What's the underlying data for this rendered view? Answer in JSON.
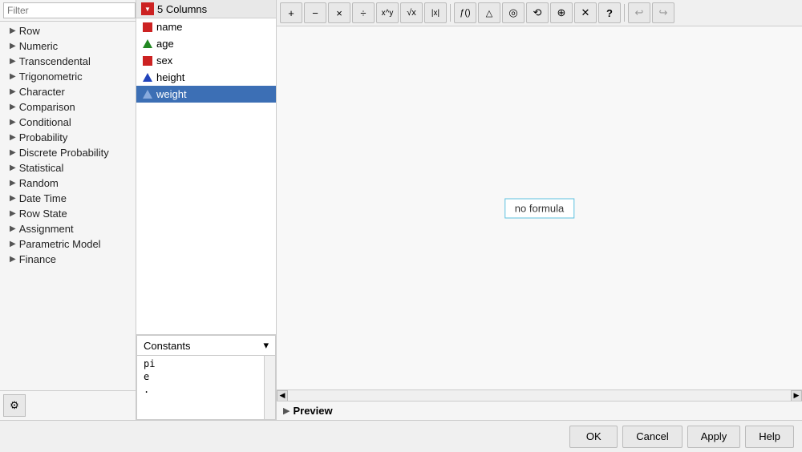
{
  "filter": {
    "placeholder": "Filter",
    "label": "Filter"
  },
  "categories": [
    {
      "id": "row",
      "label": "Row"
    },
    {
      "id": "numeric",
      "label": "Numeric"
    },
    {
      "id": "transcendental",
      "label": "Transcendental"
    },
    {
      "id": "trigonometric",
      "label": "Trigonometric"
    },
    {
      "id": "character",
      "label": "Character"
    },
    {
      "id": "comparison",
      "label": "Comparison"
    },
    {
      "id": "conditional",
      "label": "Conditional"
    },
    {
      "id": "probability",
      "label": "Probability"
    },
    {
      "id": "discrete-probability",
      "label": "Discrete Probability"
    },
    {
      "id": "statistical",
      "label": "Statistical"
    },
    {
      "id": "random",
      "label": "Random"
    },
    {
      "id": "date-time",
      "label": "Date Time"
    },
    {
      "id": "row-state",
      "label": "Row State"
    },
    {
      "id": "assignment",
      "label": "Assignment"
    },
    {
      "id": "parametric-model",
      "label": "Parametric Model"
    },
    {
      "id": "finance",
      "label": "Finance"
    }
  ],
  "columns_header": {
    "icon_label": "▼",
    "title": "5 Columns"
  },
  "columns": [
    {
      "id": "name",
      "label": "name",
      "type": "nominal"
    },
    {
      "id": "age",
      "label": "age",
      "type": "ordinal-num"
    },
    {
      "id": "sex",
      "label": "sex",
      "type": "nominal"
    },
    {
      "id": "height",
      "label": "height",
      "type": "continuous"
    },
    {
      "id": "weight",
      "label": "weight",
      "type": "continuous",
      "selected": true
    }
  ],
  "constants": {
    "label": "Constants",
    "items": [
      "pi",
      "e",
      "."
    ]
  },
  "toolbar": {
    "buttons": [
      {
        "id": "add",
        "symbol": "+",
        "label": "Add"
      },
      {
        "id": "subtract",
        "symbol": "−",
        "label": "Subtract"
      },
      {
        "id": "multiply",
        "symbol": "×",
        "label": "Multiply"
      },
      {
        "id": "divide",
        "symbol": "÷",
        "label": "Divide"
      },
      {
        "id": "power",
        "symbol": "^",
        "label": "Power"
      },
      {
        "id": "sqrt",
        "symbol": "√",
        "label": "Square Root"
      },
      {
        "id": "abs",
        "symbol": "|x|",
        "label": "Absolute Value"
      },
      {
        "id": "sep1",
        "type": "sep"
      },
      {
        "id": "func-t",
        "symbol": "t()",
        "label": "Function T"
      },
      {
        "id": "up",
        "symbol": "▲",
        "label": "Up"
      },
      {
        "id": "circle",
        "symbol": "○",
        "label": "Circle"
      },
      {
        "id": "rotate",
        "symbol": "↺",
        "label": "Rotate"
      },
      {
        "id": "target",
        "symbol": "⊕",
        "label": "Target"
      },
      {
        "id": "cross",
        "symbol": "✕",
        "label": "Cross"
      },
      {
        "id": "help",
        "symbol": "?",
        "label": "Help"
      },
      {
        "id": "sep2",
        "type": "sep"
      },
      {
        "id": "undo",
        "symbol": "↩",
        "label": "Undo"
      },
      {
        "id": "redo",
        "symbol": "↪",
        "label": "Redo"
      }
    ]
  },
  "formula_area": {
    "placeholder_text": "no formula"
  },
  "preview": {
    "arrow": "▶",
    "label": "Preview"
  },
  "bottom_buttons": {
    "ok": "OK",
    "cancel": "Cancel",
    "apply": "Apply",
    "help": "Help"
  },
  "settings_icon": "⚙"
}
